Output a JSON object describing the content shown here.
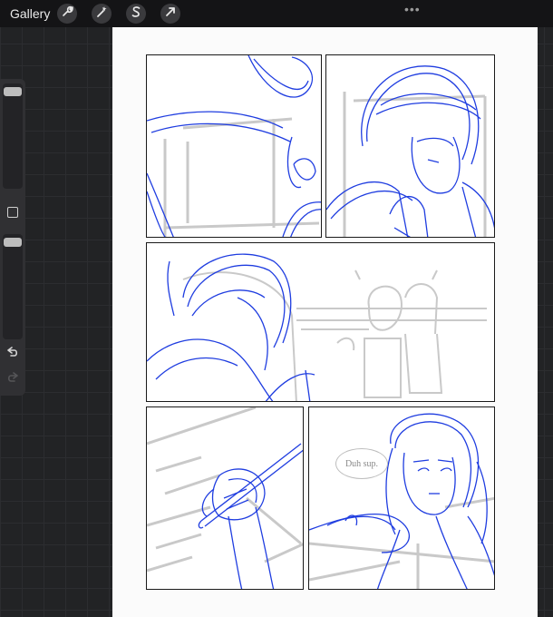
{
  "app": {
    "gallery_label": "Gallery",
    "more_menu": "•••"
  },
  "toolbar": {
    "actions_icon": "wrench-icon",
    "adjustments_icon": "magic-wand-icon",
    "selection_icon": "selection-s-icon",
    "transform_icon": "arrow-cursor-icon"
  },
  "sidebar": {
    "brush_size_level": 0.95,
    "opacity_level": 0.95,
    "modify_icon": "square-icon",
    "undo_icon": "undo-arrow-icon",
    "redo_icon": "redo-arrow-icon"
  },
  "canvas": {
    "panels": [
      {
        "id": "panel-1",
        "sketch": "figure-reaching"
      },
      {
        "id": "panel-2",
        "sketch": "girl-hand-to-chin"
      },
      {
        "id": "panel-3",
        "sketch": "over-shoulder-classroom"
      },
      {
        "id": "panel-4",
        "sketch": "hand-holding-pen"
      },
      {
        "id": "panel-5",
        "sketch": "girl-portrait"
      }
    ],
    "speech_bubble_text": "Duh sup."
  },
  "colors": {
    "sketch_blue": "#1f3de0",
    "sketch_gray": "#c9c9c9"
  }
}
